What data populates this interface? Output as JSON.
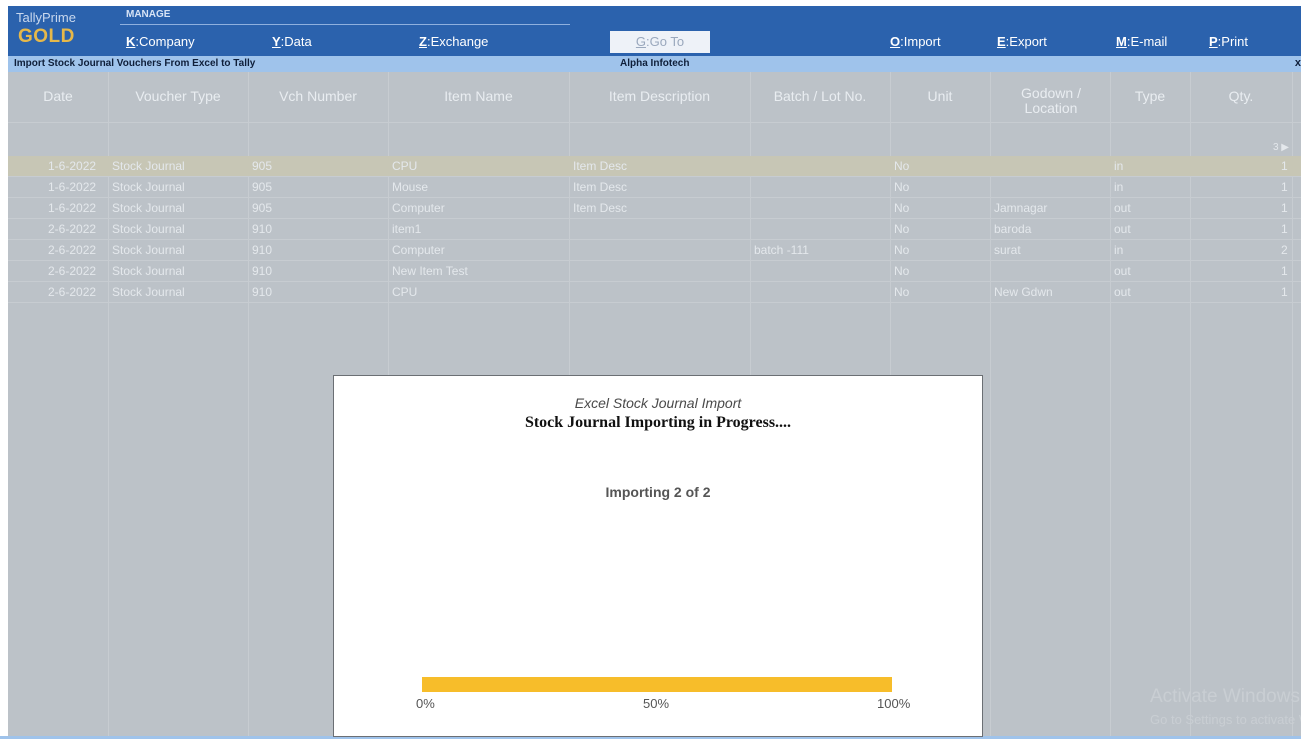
{
  "app": {
    "brand_sub": "TallyPrime",
    "brand_main": "GOLD"
  },
  "menu": {
    "group_label": "MANAGE",
    "items": [
      {
        "key": "K",
        "label": "Company"
      },
      {
        "key": "Y",
        "label": "Data"
      },
      {
        "key": "Z",
        "label": "Exchange"
      }
    ],
    "goto": {
      "key": "G",
      "label": "Go To"
    },
    "right_items": [
      {
        "key": "O",
        "label": "Import"
      },
      {
        "key": "E",
        "label": "Export"
      },
      {
        "key": "M",
        "label": "E-mail"
      },
      {
        "key": "P",
        "label": "Print"
      }
    ]
  },
  "subbar": {
    "title": "Import Stock Journal Vouchers From Excel to Tally",
    "company": "Alpha Infotech",
    "close": "x"
  },
  "table": {
    "columns": [
      "Date",
      "Voucher Type",
      "Vch Number",
      "Item Name",
      "Item Description",
      "Batch / Lot No.",
      "Unit",
      "Godown / Location",
      "Type",
      "Qty."
    ],
    "pager": "3 ▶",
    "rows": [
      {
        "date": "1-6-2022",
        "voucher_type": "Stock Journal",
        "vch_number": "905",
        "item_name": "CPU",
        "item_description": "Item Desc",
        "batch": "",
        "unit": "No",
        "godown": "",
        "type": "in",
        "qty": "1"
      },
      {
        "date": "1-6-2022",
        "voucher_type": "Stock Journal",
        "vch_number": "905",
        "item_name": "Mouse",
        "item_description": "Item Desc",
        "batch": "",
        "unit": "No",
        "godown": "",
        "type": "in",
        "qty": "1"
      },
      {
        "date": "1-6-2022",
        "voucher_type": "Stock Journal",
        "vch_number": "905",
        "item_name": "Computer",
        "item_description": "Item Desc",
        "batch": "",
        "unit": "No",
        "godown": "Jamnagar",
        "type": "out",
        "qty": "1"
      },
      {
        "date": "2-6-2022",
        "voucher_type": "Stock Journal",
        "vch_number": "910",
        "item_name": "item1",
        "item_description": "",
        "batch": "",
        "unit": "No",
        "godown": "baroda",
        "type": "out",
        "qty": "1"
      },
      {
        "date": "2-6-2022",
        "voucher_type": "Stock Journal",
        "vch_number": "910",
        "item_name": "Computer",
        "item_description": "",
        "batch": "batch -111",
        "unit": "No",
        "godown": "surat",
        "type": "in",
        "qty": "2"
      },
      {
        "date": "2-6-2022",
        "voucher_type": "Stock Journal",
        "vch_number": "910",
        "item_name": "New Item Test",
        "item_description": "",
        "batch": "",
        "unit": "No",
        "godown": "",
        "type": "out",
        "qty": "1"
      },
      {
        "date": "2-6-2022",
        "voucher_type": "Stock Journal",
        "vch_number": "910",
        "item_name": "CPU",
        "item_description": "",
        "batch": "",
        "unit": "No",
        "godown": "New Gdwn",
        "type": "out",
        "qty": "1"
      }
    ]
  },
  "modal": {
    "subtitle": "Excel Stock Journal Import",
    "title": "Stock Journal Importing in Progress....",
    "status": "Importing 2 of 2",
    "progress": 1.0,
    "ticks": [
      "0%",
      "50%",
      "100%"
    ],
    "bar_color": "#f7bd2a"
  },
  "watermark": {
    "line1": "Activate Windows",
    "line2": "Go to Settings to activate Windows."
  },
  "colors": {
    "header_bg": "#2b62ad",
    "brand_gold": "#e6b84a",
    "subbar_bg": "#9fc3eb",
    "grid_bg": "#bcc2c8",
    "row_highlight": "#c7c6b5"
  }
}
